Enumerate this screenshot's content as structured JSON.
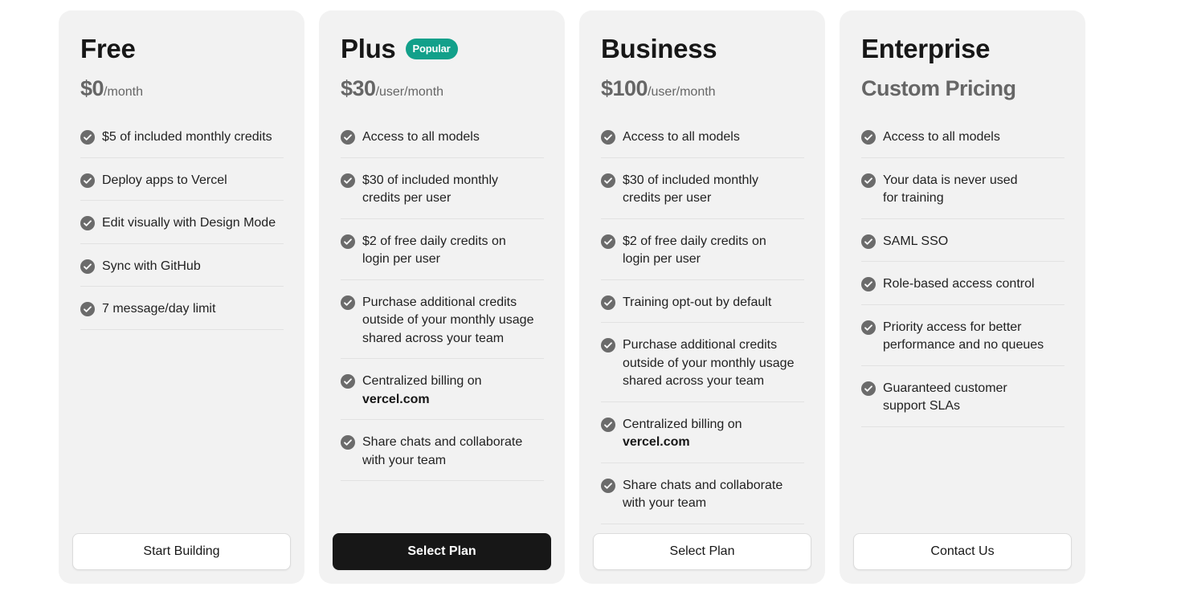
{
  "plans": [
    {
      "name": "Free",
      "badge": "",
      "price": "$0",
      "period": "/month",
      "features": [
        "$5 of included monthly credits",
        "Deploy apps to Vercel",
        "Edit visually with Design Mode",
        "Sync with GitHub",
        "7 message/day limit"
      ],
      "button": "Start Building"
    },
    {
      "name": "Plus",
      "badge": "Popular",
      "price": "$30",
      "period": "/user/month",
      "features": [
        "Access to all models",
        "$30 of included monthly\ncredits per user",
        "$2 of free daily credits on\nlogin per user",
        "Purchase additional credits\noutside of your monthly usage\nshared across your team",
        "Centralized billing on",
        "Share chats and collaborate\nwith your team"
      ],
      "billing_link": "vercel.com",
      "button": "Select Plan"
    },
    {
      "name": "Business",
      "badge": "",
      "price": "$100",
      "period": "/user/month",
      "features": [
        "Access to all models",
        "$30 of included monthly\ncredits per user",
        "$2 of free daily credits on\nlogin per user",
        "Training opt-out by default",
        "Purchase additional credits\noutside of your monthly usage\nshared across your team",
        "Centralized billing on",
        "Share chats and collaborate\nwith your team"
      ],
      "billing_link": "vercel.com",
      "button": "Select Plan"
    },
    {
      "name": "Enterprise",
      "badge": "",
      "price": "Custom Pricing",
      "period": "",
      "features": [
        "Access to all models",
        "Your data is never used\nfor training",
        "SAML SSO",
        "Role-based access control",
        "Priority access for better\nperformance and no queues",
        "Guaranteed customer\nsupport SLAs"
      ],
      "button": "Contact Us"
    }
  ],
  "colors": {
    "card_bg": "#f2f2f2",
    "badge_bg": "#12a08a",
    "primary_button": "#171717",
    "check_icon": "#6b6b6b"
  },
  "icons": {
    "feature_check": "check-circle-icon"
  }
}
